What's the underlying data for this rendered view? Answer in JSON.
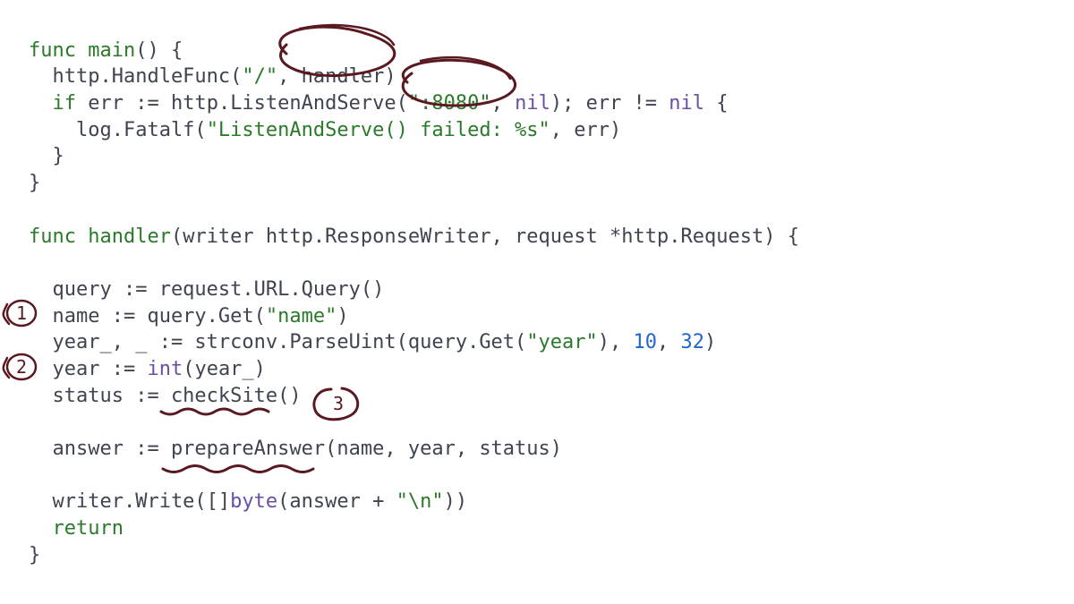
{
  "tokens": {
    "l1_func": "func",
    "l1_main": "main",
    "l1_rest": "() {",
    "l2_a": "  http.HandleFunc(",
    "l2_s1": "\"/\"",
    "l2_b": ", handler)",
    "l3_if": "if",
    "l3_a": "err := http.ListenAndServe(",
    "l3_s": "\":8080\"",
    "l3_b": ", ",
    "l3_nil": "nil",
    "l3_c": "); err != ",
    "l3_nil2": "nil",
    "l3_d": " {",
    "l4_a": "    log.Fatalf(",
    "l4_s": "\"ListenAndServe() failed: %s\"",
    "l4_b": ", err)",
    "l5": "  }",
    "l6": "}",
    "l8_func": "func",
    "l8_name": "handler",
    "l8_sig": "(writer http.ResponseWriter, request *http.Request) {",
    "l10": "  query := request.URL.Query()",
    "l11_a": "  name := query.Get(",
    "l11_s": "\"name\"",
    "l11_b": ")",
    "l12_a": "  year_, _ := strconv.ParseUint(query.Get(",
    "l12_s": "\"year\"",
    "l12_b": "), ",
    "l12_n1": "10",
    "l12_c": ", ",
    "l12_n2": "32",
    "l12_d": ")",
    "l13_a": "  year := ",
    "l13_int": "int",
    "l13_b": "(year_)",
    "l14": "  status := checkSite()",
    "l16": "  answer := prepareAnswer(name, year, status)",
    "l18_a": "  writer.Write([]",
    "l18_byte": "byte",
    "l18_b": "(answer + ",
    "l18_s": "\"\\n\"",
    "l18_c": "))",
    "l19_ret": "return",
    "l20": "}"
  },
  "annotations": {
    "circle_handler": "handler",
    "circle_port": ":8080",
    "marker_1": "1",
    "marker_2": "2",
    "marker_3": "3",
    "underline_checkSite": "checkSite",
    "underline_prepareAnswer": "prepareAnswer"
  }
}
